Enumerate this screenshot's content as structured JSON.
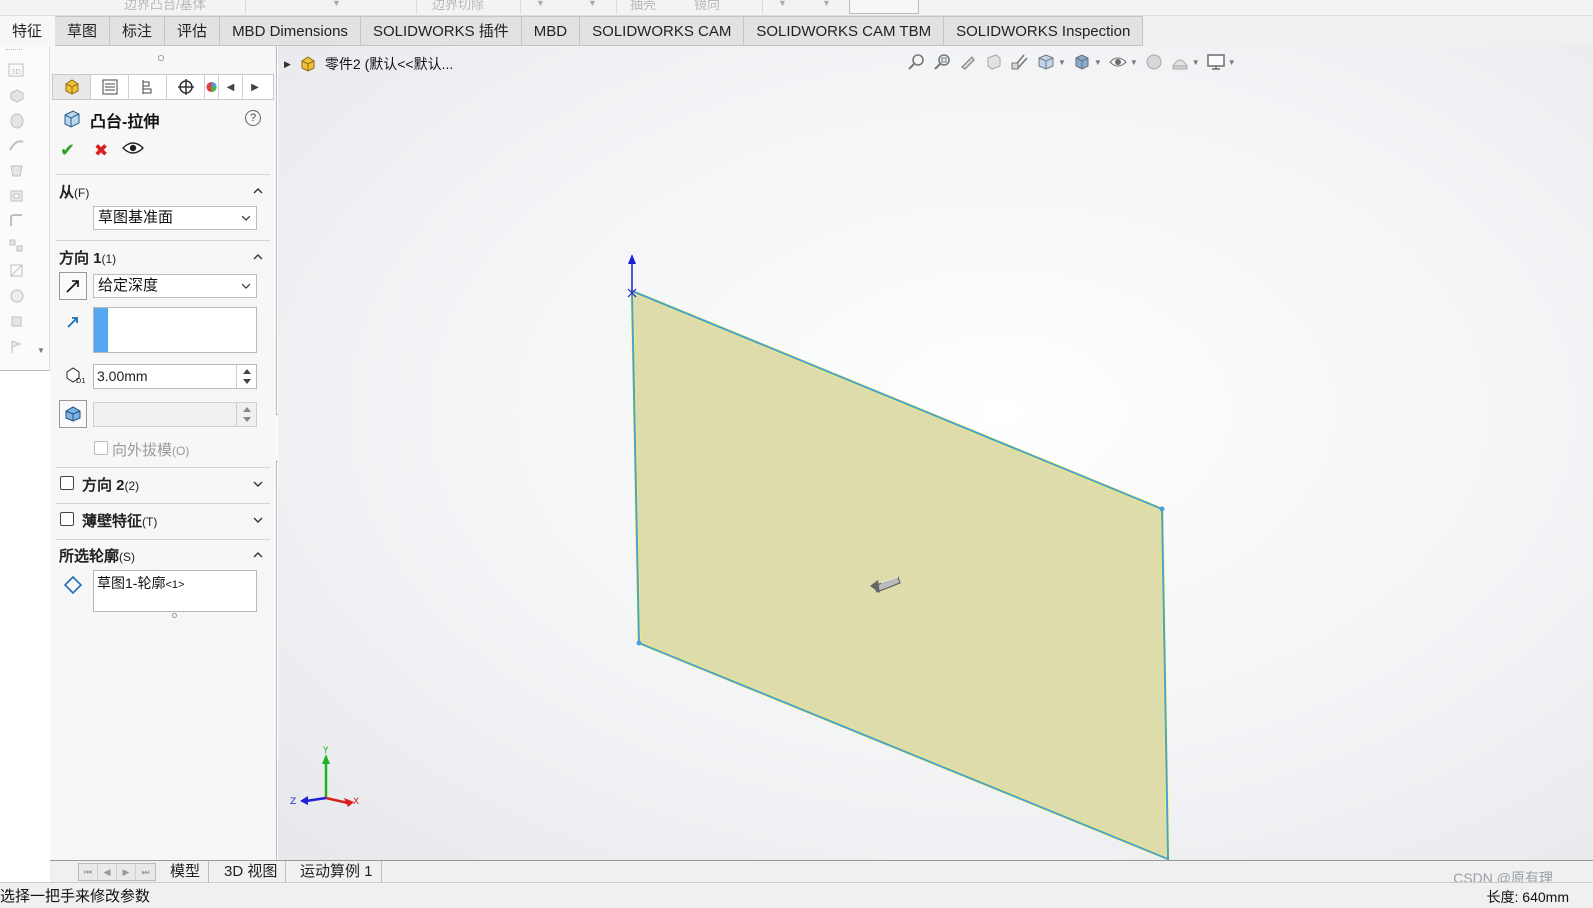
{
  "ribbon_top": {
    "items": [
      "边界凸台/基体",
      "边界切除",
      "抽壳",
      "镜向"
    ]
  },
  "tabs": [
    {
      "label": "特征",
      "active": true
    },
    {
      "label": "草图"
    },
    {
      "label": "标注"
    },
    {
      "label": "评估"
    },
    {
      "label": "MBD Dimensions"
    },
    {
      "label": "SOLIDWORKS 插件"
    },
    {
      "label": "MBD"
    },
    {
      "label": "SOLIDWORKS CAM"
    },
    {
      "label": "SOLIDWORKS CAM TBM"
    },
    {
      "label": "SOLIDWORKS Inspection"
    }
  ],
  "property_manager": {
    "title": "凸台-拉伸",
    "help_glyph": "?",
    "from": {
      "heading": "从",
      "key": "(F)",
      "value": "草图基准面"
    },
    "direction1": {
      "heading": "方向 1",
      "key": "(1)",
      "end_condition": "给定深度",
      "depth": "3.00mm",
      "draft_outward": "向外拔模",
      "draft_key": "(O)"
    },
    "direction2": {
      "heading": "方向 2",
      "key": "(2)"
    },
    "thin_feature": {
      "heading": "薄壁特征",
      "key": "(T)"
    },
    "selected_contours": {
      "heading": "所选轮廓",
      "key": "(S)",
      "item_main": "草图1-轮廓",
      "item_suffix": "<1>"
    }
  },
  "feature_tree": {
    "root": "零件2  (默认<<默认..."
  },
  "view_toolbar": {
    "icons": [
      "zoom-to-fit-icon",
      "zoom-area-icon",
      "previous-view-icon",
      "section-view-icon",
      "dynamic-annotation-icon",
      "view-orientation-icon",
      "display-style-icon",
      "hide-show-items-icon",
      "edit-appearance-icon",
      "apply-scene-icon",
      "view-settings-icon"
    ]
  },
  "triad": {
    "x": "X",
    "y": "Y",
    "z": "Z"
  },
  "colors": {
    "sketch_face": "#dcdaa5",
    "edge": "#4a9fe0",
    "highlight": "#ffff3c",
    "axis_x": "#d82020",
    "axis_y": "#20b020",
    "axis_z": "#2020d8"
  },
  "bottom_tabs": [
    "模型",
    "3D 视图",
    "运动算例 1"
  ],
  "status": {
    "left": "选择一把手来修改参数",
    "right": "长度: 640mm"
  },
  "watermark": "CSDN @原有理"
}
